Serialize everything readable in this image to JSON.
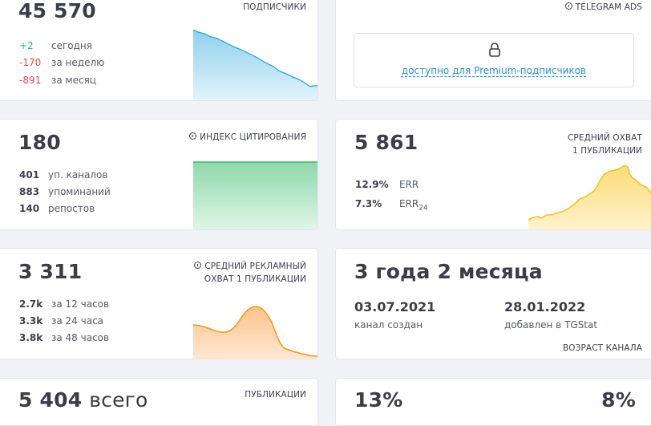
{
  "subscribers": {
    "value": "45 570",
    "label": "ПОДПИСЧИКИ",
    "stats": [
      {
        "value": "+2",
        "label": "сегодня",
        "trend": "up"
      },
      {
        "value": "-170",
        "label": "за неделю",
        "trend": "down"
      },
      {
        "value": "-891",
        "label": "за месяц",
        "trend": "down"
      }
    ]
  },
  "ads": {
    "label": "TELEGRAM ADS",
    "locked_text": "доступно для Premium-подписчиков"
  },
  "citation": {
    "value": "180",
    "label": "ИНДЕКС ЦИТИРОВАНИЯ",
    "stats": [
      {
        "value": "401",
        "label": "уп. каналов"
      },
      {
        "value": "883",
        "label": "упоминаний"
      },
      {
        "value": "140",
        "label": "репостов"
      }
    ]
  },
  "reach": {
    "value": "5 861",
    "label_line1": "СРЕДНИЙ ОХВАТ",
    "label_line2": "1 ПУБЛИКАЦИИ",
    "err": {
      "value": "12.9%",
      "label": "ERR"
    },
    "err24": {
      "value": "7.3%",
      "label": "ERR",
      "sub": "24"
    }
  },
  "ad_reach": {
    "value": "3 311",
    "label_line1": "СРЕДНИЙ РЕКЛАМНЫЙ",
    "label_line2": "ОХВАТ 1 ПУБЛИКАЦИИ",
    "stats": [
      {
        "value": "2.7k",
        "label": "за 12 часов"
      },
      {
        "value": "3.3k",
        "label": "за 24 часа"
      },
      {
        "value": "3.8k",
        "label": "за 48 часов"
      }
    ]
  },
  "age": {
    "value": "3 года 2 месяца",
    "created_date": "03.07.2021",
    "created_label": "канал создан",
    "added_date": "28.01.2022",
    "added_label": "добавлен в TGStat",
    "label": "ВОЗРАСТ КАНАЛА"
  },
  "publications": {
    "value": "5 404",
    "suffix": "всего",
    "label": "ПУБЛИКАЦИИ"
  },
  "bottom_right": {
    "left_value": "13%",
    "right_value": "8%"
  },
  "colors": {
    "positive": "#2bb673",
    "negative": "#e5484d",
    "blue": "#3aaedc",
    "green": "#39b86a",
    "yellow": "#f5c22a",
    "orange": "#f59a22",
    "link": "#2a8fd2"
  }
}
